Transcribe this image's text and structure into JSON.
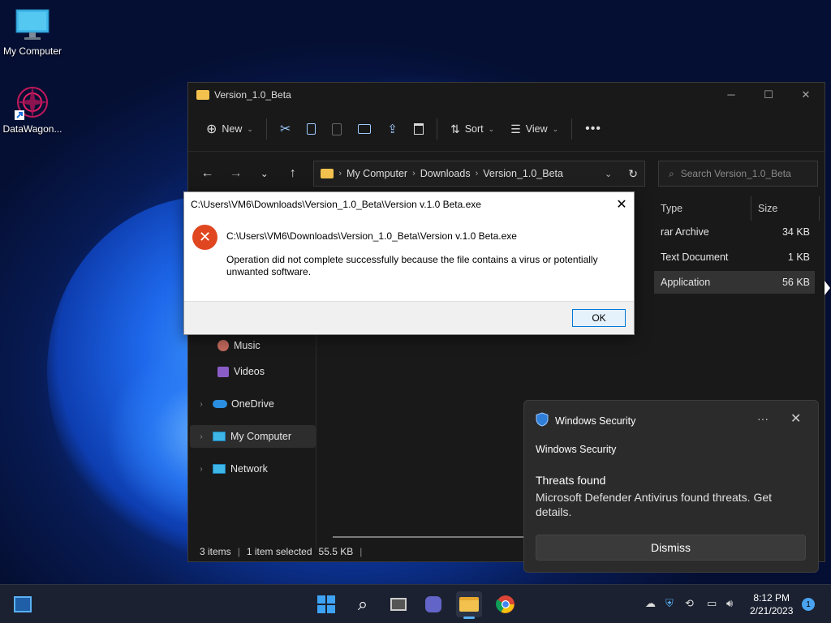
{
  "desktop": {
    "icons": [
      {
        "label": "My Computer"
      },
      {
        "label": "DataWagon..."
      }
    ]
  },
  "explorer": {
    "title": "Version_1.0_Beta",
    "toolbar": {
      "new_label": "New",
      "sort_label": "Sort",
      "view_label": "View"
    },
    "breadcrumb": [
      "My Computer",
      "Downloads",
      "Version_1.0_Beta"
    ],
    "search_placeholder": "Search Version_1.0_Beta",
    "nav": [
      {
        "label": "Music"
      },
      {
        "label": "Videos"
      },
      {
        "label": "OneDrive"
      },
      {
        "label": "My Computer"
      },
      {
        "label": "Network"
      }
    ],
    "columns": {
      "type": "Type",
      "size": "Size"
    },
    "rows": [
      {
        "type": "rar Archive",
        "size": "34 KB"
      },
      {
        "type": "Text Document",
        "size": "1 KB"
      },
      {
        "type": "Application",
        "size": "56 KB"
      }
    ],
    "status": {
      "items": "3 items",
      "selected": "1 item selected",
      "size": "55.5 KB"
    }
  },
  "dialog": {
    "title": "C:\\Users\\VM6\\Downloads\\Version_1.0_Beta\\Version v.1.0 Beta.exe",
    "path": "C:\\Users\\VM6\\Downloads\\Version_1.0_Beta\\Version v.1.0 Beta.exe",
    "message": "Operation did not complete successfully because the file contains a virus or potentially unwanted software.",
    "ok_label": "OK"
  },
  "toast": {
    "header": "Windows Security",
    "app": "Windows Security",
    "title": "Threats found",
    "body": "Microsoft Defender Antivirus found threats. Get details.",
    "dismiss_label": "Dismiss"
  },
  "taskbar": {
    "time": "8:12 PM",
    "date": "2/21/2023",
    "notification_count": "1"
  },
  "colors": {
    "accent": "#0078d7",
    "error": "#e0461f",
    "security_shield": "#2f7fd8"
  }
}
